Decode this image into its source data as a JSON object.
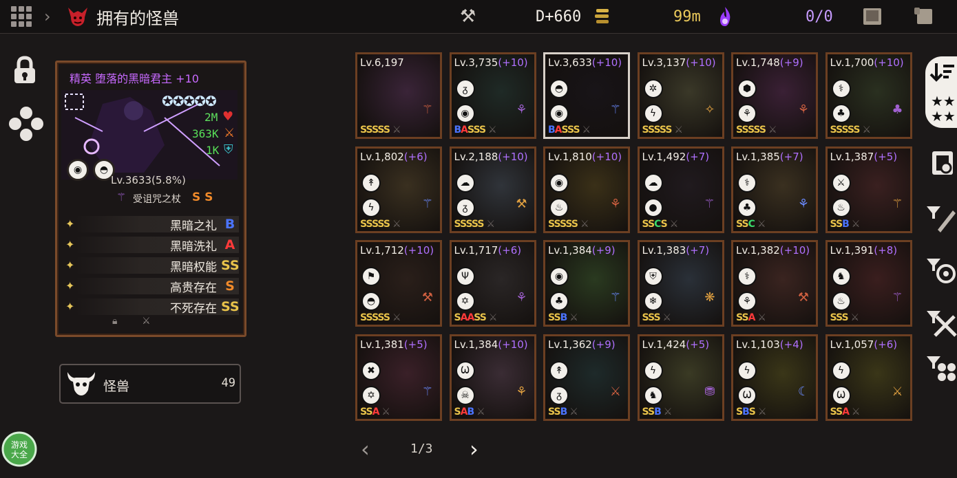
{
  "header": {
    "title": "拥有的怪兽",
    "currency_d": "D+660",
    "currency_m": "99m",
    "counter": "0/0"
  },
  "card": {
    "name": "精英 堕落的黑暗君主 +10",
    "hp": "2M",
    "atk": "363K",
    "def": "1K",
    "level_line": "Lv.3633(5.8%)",
    "weapon": "受诅咒之杖",
    "weapon_grades": "S S",
    "skills": [
      {
        "name": "黑暗之礼",
        "grade": "B",
        "color": "#4b74ff"
      },
      {
        "name": "黑暗洗礼",
        "grade": "A",
        "color": "#ff3a3a"
      },
      {
        "name": "黑暗权能",
        "grade": "SS",
        "color": "#e9c34a"
      },
      {
        "name": "高贵存在",
        "grade": "S",
        "color": "#f08a2a"
      },
      {
        "name": "不死存在",
        "grade": "SS",
        "color": "#e9c34a"
      }
    ]
  },
  "monster_button": {
    "label": "怪兽",
    "count": "49"
  },
  "pagination": {
    "page": "1/3"
  },
  "monsters": [
    {
      "lv": "Lv.6,197",
      "plus": "",
      "i1": "",
      "i2": "",
      "grades": "SSSSS",
      "c": "#3a2438"
    },
    {
      "lv": "Lv.3,735",
      "plus": "(+10)",
      "i1": "ᵹ",
      "i2": "◉",
      "grades": "BASSS",
      "c": "#1f2a26"
    },
    {
      "lv": "Lv.3,633",
      "plus": "(+10)",
      "i1": "◓",
      "i2": "◉",
      "grades": "BASSS",
      "c": "#181418"
    },
    {
      "lv": "Lv.3,137",
      "plus": "(+10)",
      "i1": "✲",
      "i2": "ϟ",
      "grades": "SSSSS",
      "c": "#3a3828"
    },
    {
      "lv": "Lv.1,748",
      "plus": "(+9)",
      "i1": "⬢",
      "i2": "⚘",
      "grades": "SSSSS",
      "c": "#3a2035"
    },
    {
      "lv": "Lv.1,700",
      "plus": "(+10)",
      "i1": "⚕",
      "i2": "♣",
      "grades": "SSSSS",
      "c": "#2a3020"
    },
    {
      "lv": "Lv.1,802",
      "plus": "(+6)",
      "i1": "↟",
      "i2": "ϟ",
      "grades": "SSSSS",
      "c": "#3a3020"
    },
    {
      "lv": "Lv.2,188",
      "plus": "(+10)",
      "i1": "☁",
      "i2": "ᵹ",
      "grades": "SSSSS",
      "c": "#30343a"
    },
    {
      "lv": "Lv.1,810",
      "plus": "(+10)",
      "i1": "◉",
      "i2": "♨",
      "grades": "SSSSS",
      "c": "#3a3018"
    },
    {
      "lv": "Lv.1,492",
      "plus": "(+7)",
      "i1": "☁",
      "i2": "●",
      "grades": "SSCS",
      "c": "#201a1e"
    },
    {
      "lv": "Lv.1,385",
      "plus": "(+7)",
      "i1": "⚕",
      "i2": "♣",
      "grades": "SSC",
      "c": "#3a3020"
    },
    {
      "lv": "Lv.1,387",
      "plus": "(+5)",
      "i1": "⚔",
      "i2": "♨",
      "grades": "SSB",
      "c": "#3a2020"
    },
    {
      "lv": "Lv.1,712",
      "plus": "(+10)",
      "i1": "⚑",
      "i2": "◓",
      "grades": "SSSSS",
      "c": "#2a1f1a"
    },
    {
      "lv": "Lv.1,717",
      "plus": "(+6)",
      "i1": "Ψ",
      "i2": "✡",
      "grades": "SAASS",
      "c": "#2a2626"
    },
    {
      "lv": "Lv.1,384",
      "plus": "(+9)",
      "i1": "◉",
      "i2": "♣",
      "grades": "SSB",
      "c": "#2a3a20"
    },
    {
      "lv": "Lv.1,383",
      "plus": "(+7)",
      "i1": "⛨",
      "i2": "❄",
      "grades": "SSS",
      "c": "#2a3038"
    },
    {
      "lv": "Lv.1,382",
      "plus": "(+10)",
      "i1": "⚕",
      "i2": "⚘",
      "grades": "SSA",
      "c": "#3a2420"
    },
    {
      "lv": "Lv.1,391",
      "plus": "(+8)",
      "i1": "♞",
      "i2": "♨",
      "grades": "SSS",
      "c": "#3a1e1e"
    },
    {
      "lv": "Lv.1,381",
      "plus": "(+5)",
      "i1": "✖",
      "i2": "✡",
      "grades": "SSA",
      "c": "#3a2028"
    },
    {
      "lv": "Lv.1,384",
      "plus": "(+10)",
      "i1": "Ѡ",
      "i2": "☠",
      "grades": "SAB",
      "c": "#3a2c34"
    },
    {
      "lv": "Lv.1,362",
      "plus": "(+9)",
      "i1": "↟",
      "i2": "ᵹ",
      "grades": "SSB",
      "c": "#1e2a2a"
    },
    {
      "lv": "Lv.1,424",
      "plus": "(+5)",
      "i1": "ϟ",
      "i2": "♞",
      "grades": "SSB",
      "c": "#3a3a24"
    },
    {
      "lv": "Lv.1,103",
      "plus": "(+4)",
      "i1": "ϟ",
      "i2": "Ѡ",
      "grades": "SBS",
      "c": "#3a3618"
    },
    {
      "lv": "Lv.1,057",
      "plus": "(+6)",
      "i1": "ϟ",
      "i2": "Ѡ",
      "grades": "SSA",
      "c": "#3a3618"
    }
  ],
  "icons": [
    "grid-icon",
    "chevron-right-icon",
    "devil-icon",
    "hammer-icon",
    "coins-icon",
    "flame-icon",
    "book-icon",
    "scroll-icon",
    "lock-icon",
    "dpad-icon",
    "sort-icon",
    "star-filter-icon",
    "screenshot-icon",
    "filter-icon"
  ]
}
